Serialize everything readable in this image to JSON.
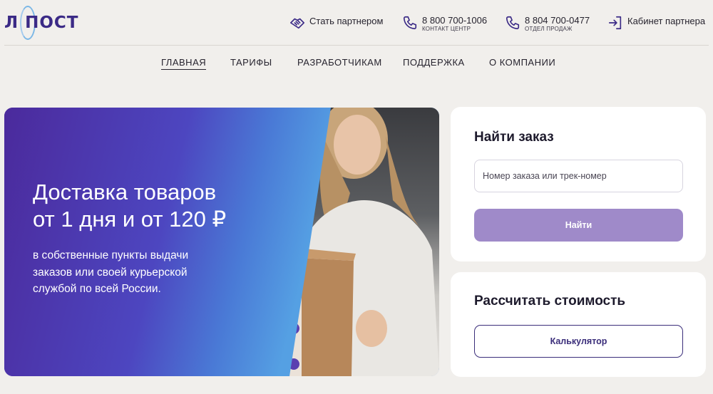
{
  "logo": {
    "text": "Л ПОСТ"
  },
  "header": {
    "partner": {
      "label": "Стать партнером",
      "icon": "handshake-icon"
    },
    "phone1": {
      "number": "8 800 700-1006",
      "caption": "КОНТАКТ ЦЕНТР",
      "icon": "phone-icon"
    },
    "phone2": {
      "number": "8 804 700-0477",
      "caption": "ОТДЕЛ ПРОДАЖ",
      "icon": "phone-icon"
    },
    "cabinet": {
      "label": "Кабинет партнера",
      "icon": "login-icon"
    }
  },
  "nav": {
    "items": [
      {
        "label": "ГЛАВНАЯ",
        "active": true
      },
      {
        "label": "ТАРИФЫ",
        "active": false
      },
      {
        "label": "РАЗРАБОТЧИКАМ",
        "active": false
      },
      {
        "label": "ПОДДЕРЖКА",
        "active": false
      },
      {
        "label": "О КОМПАНИИ",
        "active": false
      }
    ]
  },
  "hero": {
    "title_line1": "Доставка товаров",
    "title_line2": "от 1 дня и от 120 ₽",
    "subtitle_line1": "в собственные пункты выдачи",
    "subtitle_line2": "заказов или своей курьерской",
    "subtitle_line3": "службой по всей России."
  },
  "find_order": {
    "title": "Найти заказ",
    "input_value": "",
    "input_placeholder": "Номер заказа или трек-номер",
    "button_label": "Найти"
  },
  "calc": {
    "title": "Рассчитать стоимость",
    "button_label": "Калькулятор"
  },
  "colors": {
    "brand_dark": "#3b2a86",
    "accent_light": "#9f8ac9",
    "hero_gradient_start": "#4b2a9c",
    "hero_gradient_end": "#4a86da",
    "page_bg": "#f1efec"
  }
}
